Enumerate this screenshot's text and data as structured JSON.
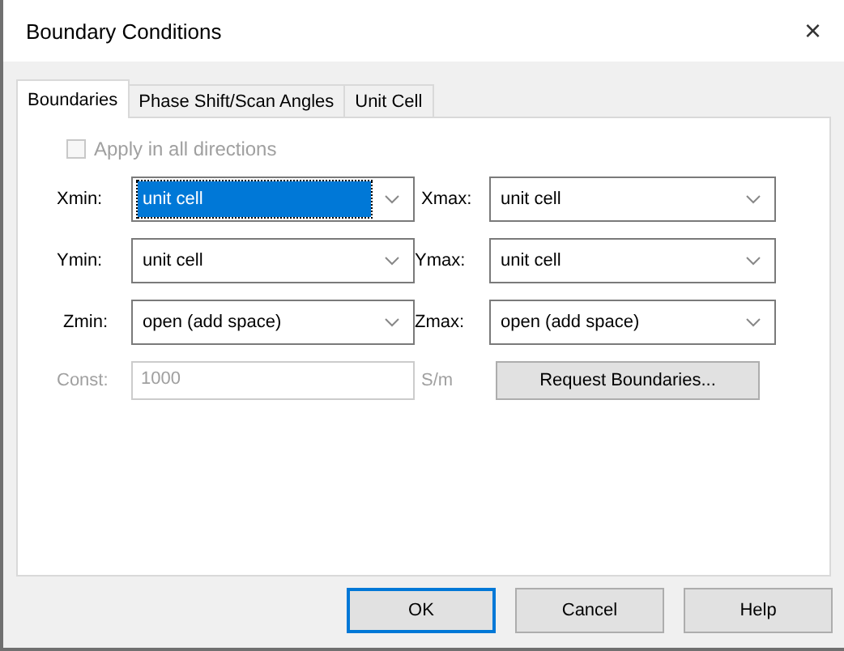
{
  "window": {
    "title": "Boundary Conditions",
    "close": "×"
  },
  "tabs": [
    {
      "label": "Boundaries",
      "selected": true
    },
    {
      "label": "Phase Shift/Scan Angles",
      "selected": false
    },
    {
      "label": "Unit Cell",
      "selected": false
    }
  ],
  "apply_all": {
    "label": "Apply in all directions",
    "checked": false,
    "disabled": true
  },
  "fields": [
    {
      "kind": "combo",
      "label": "Xmin:",
      "value": "unit cell",
      "focused": true,
      "disabled": false
    },
    {
      "kind": "combo",
      "label": "Xmax:",
      "value": "unit cell",
      "focused": false,
      "disabled": false
    },
    {
      "kind": "combo",
      "label": "Ymin:",
      "value": "unit cell",
      "focused": false,
      "disabled": false
    },
    {
      "kind": "combo",
      "label": "Ymax:",
      "value": "unit cell",
      "focused": false,
      "disabled": false
    },
    {
      "kind": "combo",
      "label": "Zmin:",
      "value": "open (add space)",
      "focused": false,
      "disabled": false
    },
    {
      "kind": "combo",
      "label": "Zmax:",
      "value": "open (add space)",
      "focused": false,
      "disabled": false
    },
    {
      "kind": "text",
      "label": "Const:",
      "value": "1000",
      "unit": "S/m",
      "focused": false,
      "disabled": true
    },
    {
      "kind": "button",
      "label": "Request Boundaries...",
      "focused": false,
      "disabled": false
    }
  ],
  "buttons": [
    {
      "label": "OK",
      "default": true
    },
    {
      "label": "Cancel",
      "default": false
    },
    {
      "label": "Help",
      "default": false
    }
  ]
}
